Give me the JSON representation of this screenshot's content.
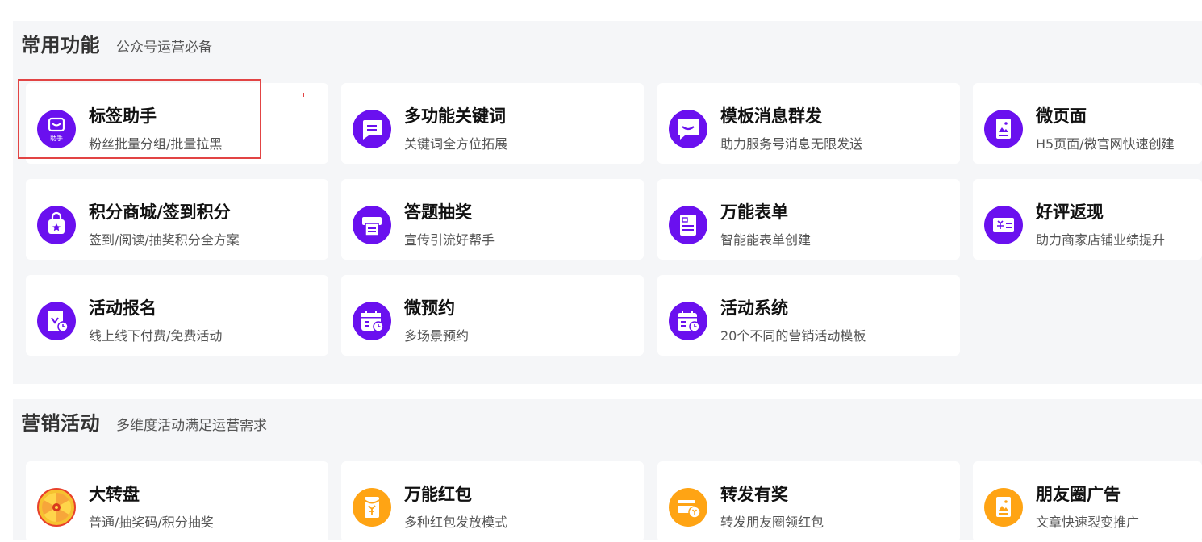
{
  "common": {
    "title": "常用功能",
    "subtitle": "公众号运营必备",
    "items": [
      {
        "title": "标签助手",
        "desc": "粉丝批量分组/批量拉黑",
        "icon": "tag-helper-icon",
        "icon_text": "助手"
      },
      {
        "title": "多功能关键词",
        "desc": "关键词全方位拓展",
        "icon": "chat-keyword-icon"
      },
      {
        "title": "模板消息群发",
        "desc": "助力服务号消息无限发送",
        "icon": "message-smile-icon"
      },
      {
        "title": "微页面",
        "desc": "H5页面/微官网快速创建",
        "icon": "page-image-icon"
      },
      {
        "title": "积分商城/签到积分",
        "desc": "签到/阅读/抽奖积分全方案",
        "icon": "shopping-bag-star-icon"
      },
      {
        "title": "答题抽奖",
        "desc": "宣传引流好帮手",
        "icon": "printer-quiz-icon"
      },
      {
        "title": "万能表单",
        "desc": "智能能表单创建",
        "icon": "form-document-icon"
      },
      {
        "title": "好评返现",
        "desc": "助力商家店铺业绩提升",
        "icon": "gift-card-icon"
      },
      {
        "title": "活动报名",
        "desc": "线上线下付费/免费活动",
        "icon": "signup-clock-icon"
      },
      {
        "title": "微预约",
        "desc": "多场景预约",
        "icon": "calendar-clock-icon"
      },
      {
        "title": "活动系统",
        "desc": "20个不同的营销活动模板",
        "icon": "calendar-clock-icon"
      }
    ]
  },
  "marketing": {
    "title": "营销活动",
    "subtitle": "多维度活动满足运营需求",
    "items": [
      {
        "title": "大转盘",
        "desc": "普通/抽奖码/积分抽奖",
        "icon": "prize-wheel-icon"
      },
      {
        "title": "万能红包",
        "desc": "多种红包发放模式",
        "icon": "red-envelope-yen-icon"
      },
      {
        "title": "转发有奖",
        "desc": "转发朋友圈领红包",
        "icon": "card-yen-icon"
      },
      {
        "title": "朋友圈广告",
        "desc": "文章快速裂变推广",
        "icon": "page-image-icon"
      }
    ]
  },
  "colors": {
    "purple": "#6a10ef",
    "orange": "#ffa414",
    "highlight": "#e24444",
    "section_bg": "#f5f6f8"
  }
}
